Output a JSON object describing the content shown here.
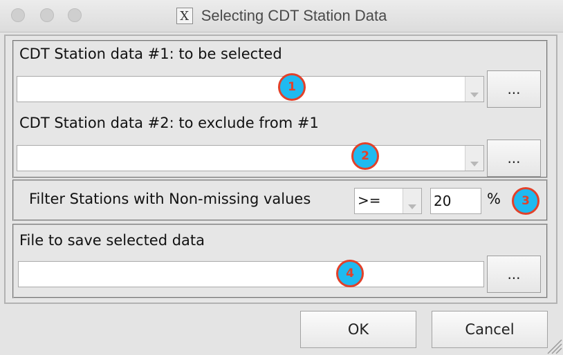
{
  "window": {
    "title": "Selecting CDT Station Data",
    "icon": "x11-icon"
  },
  "station1": {
    "label": "CDT Station data #1: to be selected",
    "value": "",
    "browse_label": "...",
    "badge": "1"
  },
  "station2": {
    "label": "CDT Station data #2: to exclude from #1",
    "value": "",
    "browse_label": "...",
    "badge": "2"
  },
  "filter": {
    "label": "Filter Stations with Non-missing values",
    "operator": ">=",
    "value": "20",
    "unit": "%",
    "badge": "3"
  },
  "output": {
    "label": "File to save selected data",
    "value": "",
    "browse_label": "...",
    "badge": "4"
  },
  "buttons": {
    "ok": "OK",
    "cancel": "Cancel"
  },
  "colors": {
    "badge_fill": "#1fbaf0",
    "badge_border": "#e2412a"
  }
}
